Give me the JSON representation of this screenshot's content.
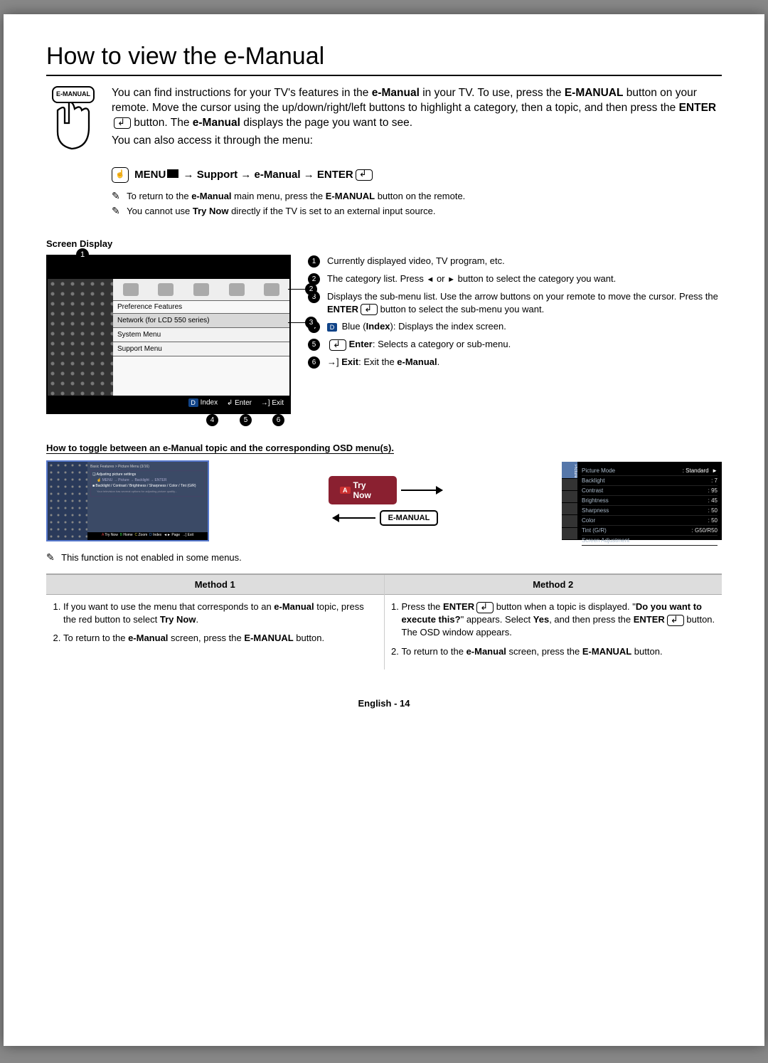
{
  "title": "How to view the e-Manual",
  "remote_button_label": "E-MANUAL",
  "intro": {
    "part1": "You can find instructions for your TV's features in the ",
    "bold1": "e-Manual",
    "part2": " in your TV. To use, press the ",
    "key1": "E-MANUAL",
    "part3": " button on your remote. Move the cursor using the up/down/right/left buttons to highlight a category, then a topic, and then press the ",
    "key2": "ENTER",
    "part4": " button. The ",
    "bold2": "e-Manual",
    "part5": " displays the page you want to see.",
    "access_line": "You can also access it through the menu:"
  },
  "menu_path": {
    "menu": "MENU",
    "arrow": "→",
    "support": "Support",
    "emanual": "e-Manual",
    "enter": "ENTER"
  },
  "notes": {
    "n1_pre": "To return to the ",
    "n1_b": "e-Manual",
    "n1_mid": " main menu, press the ",
    "n1_key": "E-MANUAL",
    "n1_post": " button on the remote.",
    "n2_pre": "You cannot use ",
    "n2_b": "Try Now",
    "n2_post": " directly if the TV is set to an external input source."
  },
  "screen_display": {
    "label": "Screen Display",
    "pref_features": "Preference Features",
    "item_network": "Network (for LCD 550 series)",
    "item_system": "System Menu",
    "item_support": "Support Menu",
    "footer_index": "Index",
    "footer_enter": "Enter",
    "footer_exit": "Exit"
  },
  "legend": [
    {
      "text": "Currently displayed video, TV program, etc."
    },
    {
      "pre": "The category list. Press ",
      "mid": " or ",
      "post": " button to select the category you want."
    },
    {
      "pre": "Displays the sub-menu list. Use the arrow buttons on your remote to move the cursor. Press the ",
      "key": "ENTER",
      "post": " button to select the sub-menu you want."
    },
    {
      "mark": "D",
      "pre": " Blue (",
      "b": "Index",
      "post": "): Displays the index screen."
    },
    {
      "b1_pre": "",
      "key": "Enter",
      "b1_post": ": Selects a category or sub-menu."
    },
    {
      "b1_pre": "",
      "key": "Exit",
      "b1_post": ": Exit the ",
      "b2": "e-Manual",
      "end": "."
    }
  ],
  "toggle_heading": "How to toggle between an e-Manual topic and the corresponding OSD menu(s).",
  "mid_buttons": {
    "try_now": "Try Now",
    "emanual_btn": "E-MANUAL"
  },
  "mini_manual": {
    "breadcrumb": "Basic Features > Picture Menu (3/16)",
    "h1": "Adjusting picture settings",
    "h2": "MENU → Picture → Backlight → ENTER",
    "h3": "Backlight / Contrast / Brightness / Sharpness / Color / Tint (G/R)",
    "footer_trynow": "Try Now",
    "footer_home": "Home",
    "footer_zoom": "Zoom",
    "footer_index": "Index",
    "footer_page": "Page",
    "footer_exit": "Exit"
  },
  "osd": {
    "rows": [
      {
        "label": "Picture Mode",
        "value": ": Standard"
      },
      {
        "label": "Backlight",
        "value": ": 7"
      },
      {
        "label": "Contrast",
        "value": ": 95"
      },
      {
        "label": "Brightness",
        "value": ": 45"
      },
      {
        "label": "Sharpness",
        "value": ": 50"
      },
      {
        "label": "Color",
        "value": ": 50"
      },
      {
        "label": "Tint (G/R)",
        "value": ": G50/R50"
      },
      {
        "label": "Screen Adjustment",
        "value": ""
      }
    ],
    "side_label": "Picture"
  },
  "func_note": "This function is not enabled in some menus.",
  "methods": {
    "h1": "Method 1",
    "h2": "Method 2",
    "m1": {
      "s1_pre": "If you want to use the menu that corresponds to an ",
      "s1_b1": "e-Manual",
      "s1_mid": " topic, press the red button to select ",
      "s1_b2": "Try Now",
      "s1_end": ".",
      "s2_pre": "To return to the ",
      "s2_b": "e-Manual",
      "s2_mid": " screen, press the ",
      "s2_key": "E-MANUAL",
      "s2_end": " button."
    },
    "m2": {
      "s1_pre": "Press the ",
      "s1_key": "ENTER",
      "s1_mid": " button when a topic is displayed. \"",
      "s1_b1": "Do you want to execute this?",
      "s1_mid2": "\" appears. Select ",
      "s1_b2": "Yes",
      "s1_mid3": ", and then press the ",
      "s1_key2": "ENTER",
      "s1_end": " button. The OSD window appears.",
      "s2_pre": "To return to the ",
      "s2_b": "e-Manual",
      "s2_mid": " screen, press the ",
      "s2_key": "E-MANUAL",
      "s2_end": " button."
    }
  },
  "footer": "English - 14"
}
